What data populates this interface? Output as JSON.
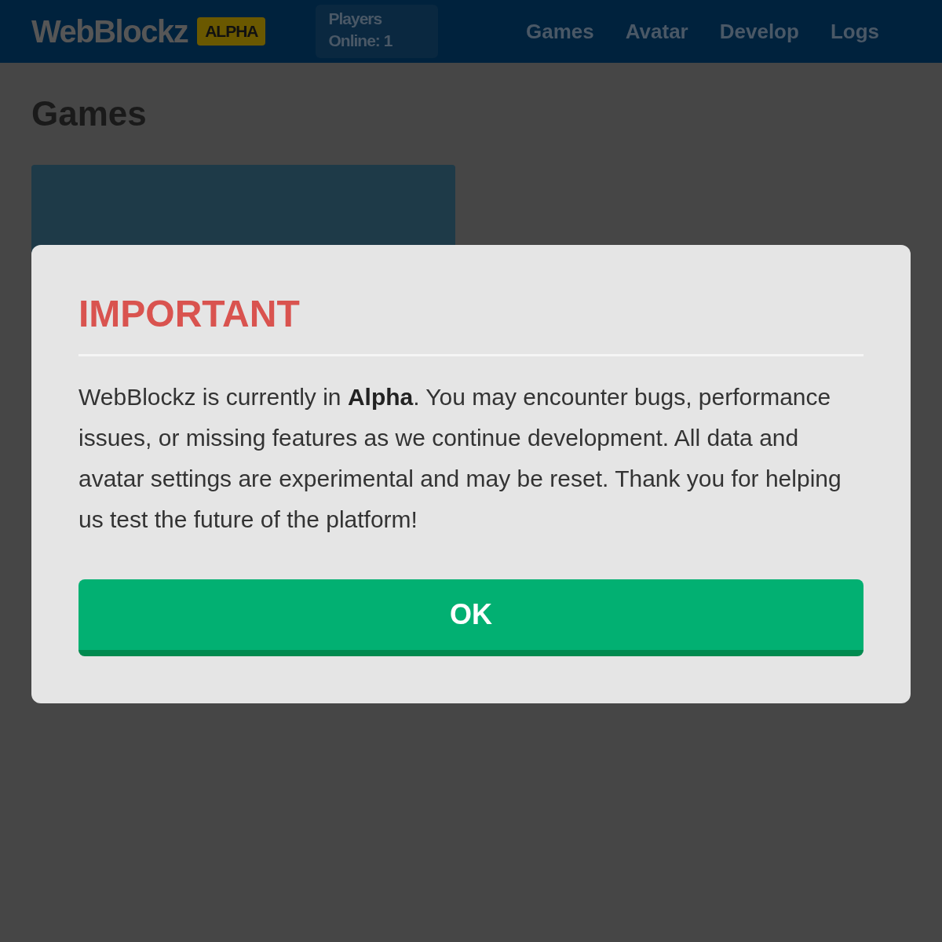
{
  "header": {
    "logo": "WebBlockz",
    "badge": "ALPHA",
    "players_online": "Players Online: 1",
    "nav": [
      "Games",
      "Avatar",
      "Develop",
      "Logs"
    ]
  },
  "page": {
    "title": "Games"
  },
  "modal": {
    "title": "IMPORTANT",
    "message": "WebBlockz is currently in **Alpha**. You may encounter bugs, performance issues, or missing features as we continue development. All data and avatar settings are experimental and may be reset. Thank you for helping us test the future of the platform!",
    "button": "OK"
  }
}
